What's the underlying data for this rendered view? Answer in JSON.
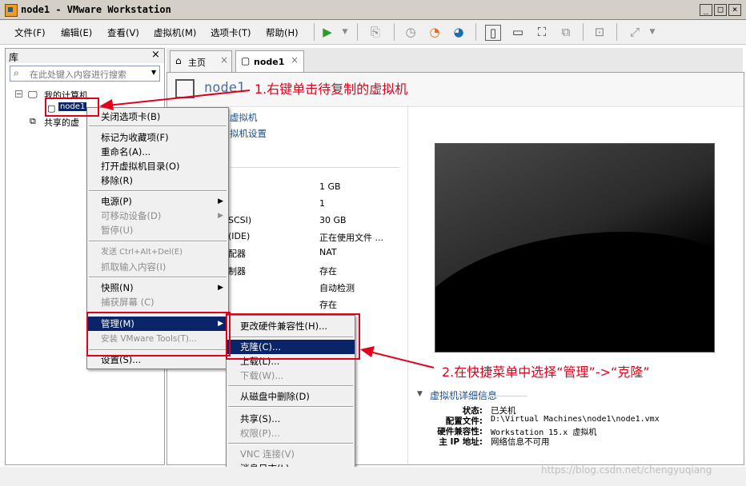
{
  "window": {
    "title": "node1 - VMware Workstation"
  },
  "menubar": {
    "items": [
      "文件(F)",
      "编辑(E)",
      "查看(V)",
      "虚拟机(M)",
      "选项卡(T)",
      "帮助(H)"
    ]
  },
  "library": {
    "title": "库",
    "search_placeholder": "在此处键入内容进行搜索",
    "tree": {
      "my_computer": "我的计算机",
      "node": "node1",
      "shared": "共享的虚"
    }
  },
  "tabs": {
    "home": "主页",
    "node": "node1"
  },
  "vm": {
    "name": "node1",
    "actions": [
      "虚拟机",
      "拟机设置"
    ],
    "hardware_left": [
      "",
      "",
      "SCSI)",
      "(IDE)",
      "配器",
      "制器",
      "",
      ""
    ],
    "hardware_right": [
      "1 GB",
      "1",
      "30 GB",
      "正在使用文件 ...",
      "NAT",
      "存在",
      "自动检测",
      "存在"
    ]
  },
  "details": {
    "header": "虚拟机详细信息",
    "rows": [
      {
        "label": "状态:",
        "value": "已关机"
      },
      {
        "label": "配置文件:",
        "value": "D:\\Virtual Machines\\node1\\node1.vmx"
      },
      {
        "label": "硬件兼容性:",
        "value": "Workstation 15.x 虚拟机"
      },
      {
        "label": "主 IP 地址:",
        "value": "网络信息不可用"
      }
    ]
  },
  "context_menu": {
    "items": [
      {
        "label": "关闭选项卡(B)",
        "disabled": false
      },
      {
        "label": "标记为收藏项(F)",
        "disabled": false
      },
      {
        "label": "重命名(A)...",
        "disabled": false
      },
      {
        "label": "打开虚拟机目录(O)",
        "disabled": false
      },
      {
        "label": "移除(R)",
        "disabled": false
      },
      {
        "label": "电源(P)",
        "disabled": false
      },
      {
        "label": "可移动设备(D)",
        "disabled": true
      },
      {
        "label": "暂停(U)",
        "disabled": true
      },
      {
        "label": "发送 Ctrl+Alt+Del(E)",
        "disabled": true
      },
      {
        "label": "抓取输入内容(I)",
        "disabled": true
      },
      {
        "label": "快照(N)",
        "disabled": false
      },
      {
        "label": "捕获屏幕 (C)",
        "disabled": true
      },
      {
        "label": "管理(M)",
        "disabled": false
      },
      {
        "label": "安装 VMware Tools(T)...",
        "disabled": true
      },
      {
        "label": "设置(S)...",
        "disabled": false
      }
    ]
  },
  "submenu": {
    "items": [
      {
        "label": "更改硬件兼容性(H)...",
        "disabled": false
      },
      {
        "label": "克隆(C)...",
        "disabled": false
      },
      {
        "label": "上载(L)...",
        "disabled": false
      },
      {
        "label": "下载(W)...",
        "disabled": true
      },
      {
        "label": "从磁盘中删除(D)",
        "disabled": false
      },
      {
        "label": "共享(S)...",
        "disabled": false
      },
      {
        "label": "权限(P)...",
        "disabled": true
      },
      {
        "label": "VNC 连接(V)",
        "disabled": true
      },
      {
        "label": "消息日志(L)",
        "disabled": false
      }
    ]
  },
  "annotations": {
    "step1": "1.右键单击待复制的虚拟机",
    "step2": "2.在快捷菜单中选择“管理”->“克隆”",
    "color": "#e3001b"
  },
  "watermark": "https://blog.csdn.net/chengyuqiang"
}
